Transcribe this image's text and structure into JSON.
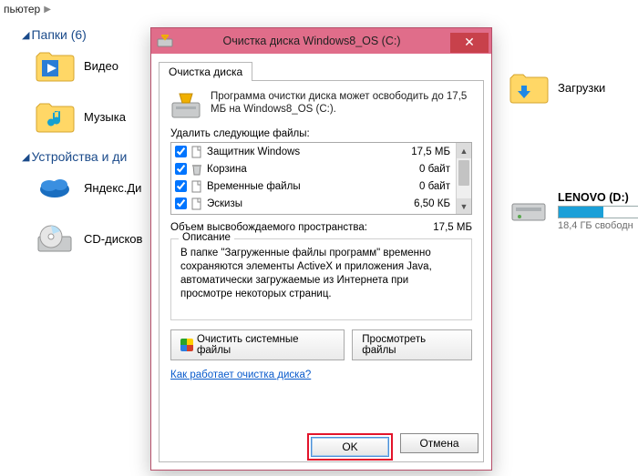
{
  "breadcrumb": {
    "text": "пьютер"
  },
  "sections": {
    "folders": {
      "title": "Папки (6)"
    },
    "devices": {
      "title": "Устройства и ди"
    }
  },
  "bg_items": {
    "video": "Видео",
    "music": "Музыка",
    "yadisk": "Яндекс.Ди",
    "cddrive": "CD-дисков",
    "downloads": "Загрузки"
  },
  "drive": {
    "name": "LENOVO (D:)",
    "free": "18,4 ГБ свободн"
  },
  "dialog": {
    "title": "Очистка диска Windows8_OS (C:)",
    "tab": "Очистка диска",
    "intro": "Программа очистки диска может освободить до 17,5 МБ на Windows8_OS (C:).",
    "list_label": "Удалить следующие файлы:",
    "items": [
      {
        "name": "Защитник Windows",
        "size": "17,5 МБ",
        "checked": true,
        "icon": "doc"
      },
      {
        "name": "Корзина",
        "size": "0 байт",
        "checked": true,
        "icon": "bin"
      },
      {
        "name": "Временные файлы",
        "size": "0 байт",
        "checked": true,
        "icon": "doc"
      },
      {
        "name": "Эскизы",
        "size": "6,50 КБ",
        "checked": true,
        "icon": "doc"
      }
    ],
    "total_label": "Объем высвобождаемого пространства:",
    "total_value": "17,5 МБ",
    "desc_title": "Описание",
    "desc_text": "В папке \"Загруженные файлы программ\" временно сохраняются элементы ActiveX и приложения Java, автоматически загружаемые из Интернета при просмотре некоторых страниц.",
    "btn_cleanup_sys": "Очистить системные файлы",
    "btn_view_files": "Просмотреть файлы",
    "link": "Как работает очистка диска?",
    "ok": "OK",
    "cancel": "Отмена"
  }
}
